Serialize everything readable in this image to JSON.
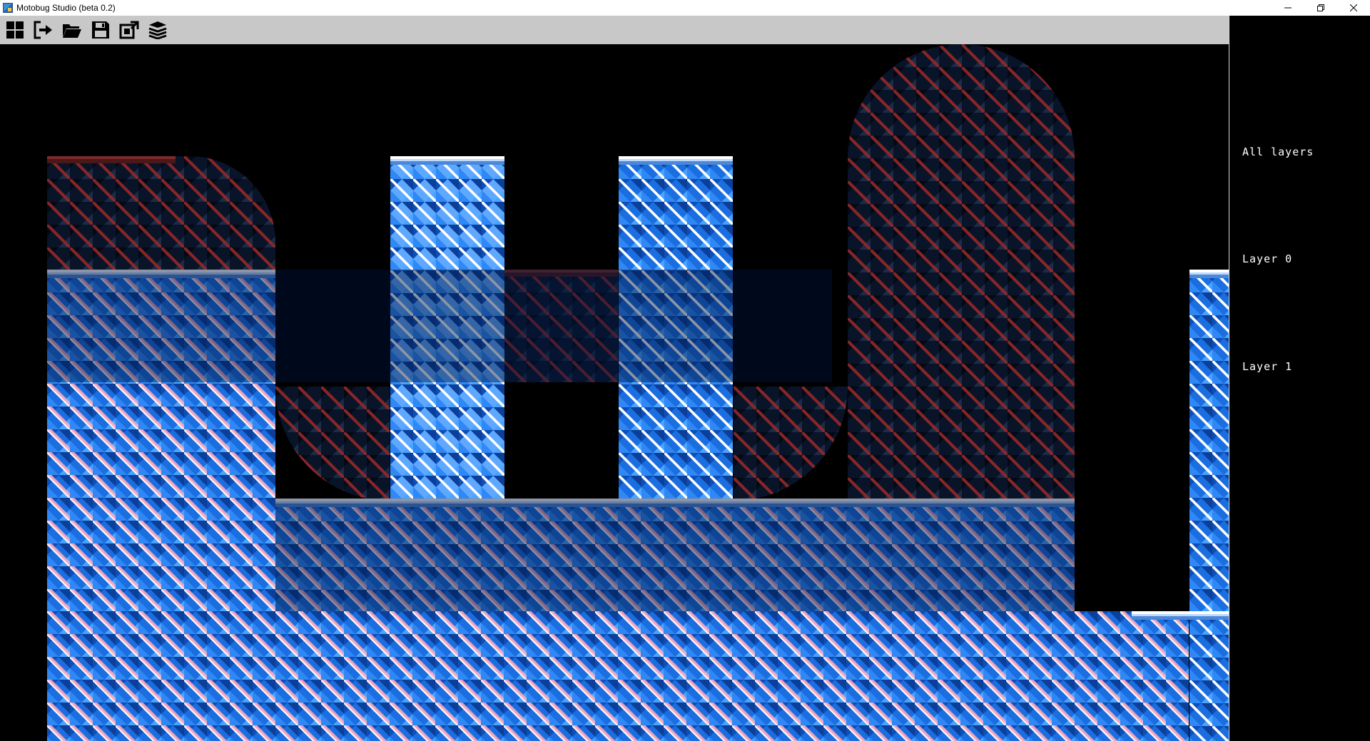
{
  "window": {
    "title": "Motobug Studio (beta 0.2)",
    "controls": [
      "minimize",
      "maximize",
      "close"
    ]
  },
  "toolbar": {
    "buttons": [
      {
        "name": "tileset-grid",
        "icon": "grid-icon"
      },
      {
        "name": "exit",
        "icon": "exit-icon"
      },
      {
        "name": "open",
        "icon": "folder-open-icon"
      },
      {
        "name": "save",
        "icon": "save-icon"
      },
      {
        "name": "export",
        "icon": "export-icon"
      },
      {
        "name": "layers",
        "icon": "layers-icon"
      }
    ]
  },
  "layers_panel": {
    "all_label": "All layers",
    "items": [
      {
        "label": "Layer 0",
        "selected": true
      },
      {
        "label": "Layer 1",
        "selected": false
      }
    ]
  },
  "colors": {
    "toolbar_bg": "#c8c8c8",
    "canvas_bg": "#000000",
    "layer0_tile": "#1a6ee0",
    "layer1_tile": "#7a2b2b"
  }
}
